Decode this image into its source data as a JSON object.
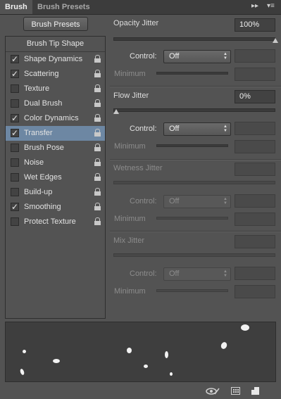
{
  "tabs": [
    "Brush",
    "Brush Presets"
  ],
  "left": {
    "presets_button": "Brush Presets",
    "tip_shape": "Brush Tip Shape",
    "items": [
      {
        "label": "Shape Dynamics",
        "checked": true
      },
      {
        "label": "Scattering",
        "checked": true
      },
      {
        "label": "Texture",
        "checked": false
      },
      {
        "label": "Dual Brush",
        "checked": false
      },
      {
        "label": "Color Dynamics",
        "checked": true
      },
      {
        "label": "Transfer",
        "checked": true,
        "selected": true
      },
      {
        "label": "Brush Pose",
        "checked": false
      },
      {
        "label": "Noise",
        "checked": false
      },
      {
        "label": "Wet Edges",
        "checked": false
      },
      {
        "label": "Build-up",
        "checked": false
      },
      {
        "label": "Smoothing",
        "checked": true
      },
      {
        "label": "Protect Texture",
        "checked": false
      }
    ]
  },
  "right": {
    "opacity": {
      "title": "Opacity Jitter",
      "value": "100%",
      "slider": 1.0,
      "control_label": "Control:",
      "control": "Off",
      "minimum_label": "Minimum"
    },
    "flow": {
      "title": "Flow Jitter",
      "value": "0%",
      "slider": 0.0,
      "control_label": "Control:",
      "control": "Off",
      "minimum_label": "Minimum"
    },
    "wetness": {
      "title": "Wetness Jitter",
      "control_label": "Control:",
      "control": "Off",
      "minimum_label": "Minimum"
    },
    "mix": {
      "title": "Mix Jitter",
      "control_label": "Control:",
      "control": "Off",
      "minimum_label": "Minimum"
    }
  },
  "colors": {
    "selected": "#6d87a3",
    "panel": "#535353",
    "tab_bar": "#3c3c3c"
  }
}
